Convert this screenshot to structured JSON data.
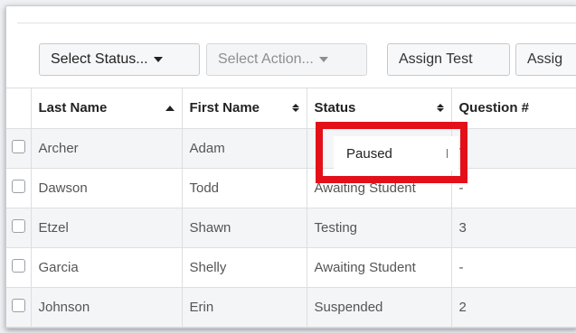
{
  "toolbar": {
    "select_status_label": "Select Status...",
    "select_action_label": "Select Action...",
    "assign_test_label": "Assign Test",
    "assign_partial_label": "Assig"
  },
  "table": {
    "headers": {
      "last_name": "Last Name",
      "first_name": "First Name",
      "status": "Status",
      "question": "Question #"
    },
    "rows": [
      {
        "last": "Archer",
        "first": "Adam",
        "status": "Paused",
        "question": "-"
      },
      {
        "last": "Dawson",
        "first": "Todd",
        "status": "Awaiting Student",
        "question": "-"
      },
      {
        "last": "Etzel",
        "first": "Shawn",
        "status": "Testing",
        "question": "3"
      },
      {
        "last": "Garcia",
        "first": "Shelly",
        "status": "Awaiting Student",
        "question": "-"
      },
      {
        "last": "Johnson",
        "first": "Erin",
        "status": "Suspended",
        "question": "2"
      }
    ]
  },
  "colors": {
    "highlight": "#e3101a"
  }
}
